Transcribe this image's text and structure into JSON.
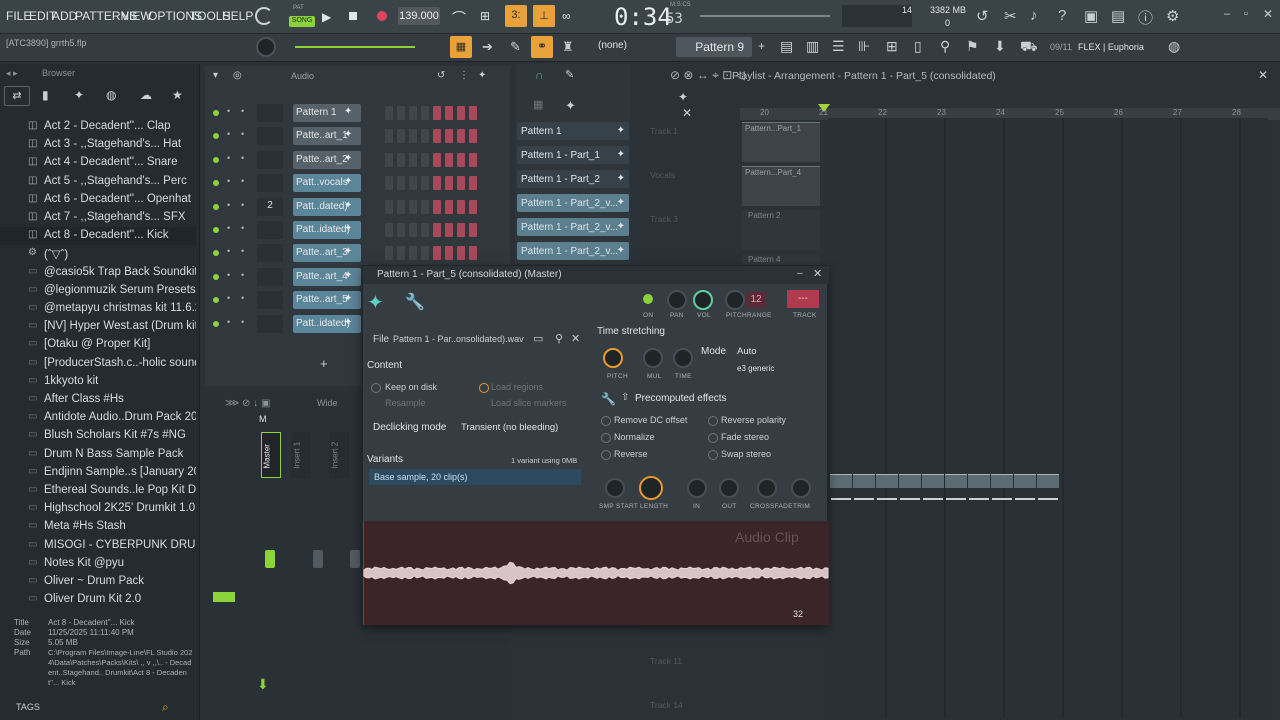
{
  "menu": [
    "FILE",
    "EDIT",
    "ADD",
    "PATTERNS",
    "VIEW",
    "OPTIONS",
    "TOOLS",
    "HELP"
  ],
  "transport": {
    "song_label": "SONG",
    "pat_label": "PAT",
    "tempo": "139.000",
    "time_main": "0:34",
    "time_sub": "53",
    "time_label": "M:S:CS",
    "meter_a": "14",
    "memory": "3382 MB",
    "memory_b": "0"
  },
  "hint": {
    "file": "[ATC3890] grrth5.flp",
    "snap": "(none)",
    "pattern": "Pattern 9",
    "version": "09/11",
    "plugin": "FLEX | Euphoria"
  },
  "browser": {
    "title": "Browser",
    "items": [
      {
        "label": "Act 2 - Decadent''... Clap",
        "icon": "file-icon"
      },
      {
        "label": "Act 3 - ,,Stagehand's... Hat",
        "icon": "file-icon"
      },
      {
        "label": "Act 4 -  Decadent''... Snare",
        "icon": "file-icon"
      },
      {
        "label": "Act 5 - ,,Stagehand's... Perc",
        "icon": "file-icon"
      },
      {
        "label": "Act 6 - Decadent''... Openhat",
        "icon": "file-icon"
      },
      {
        "label": "Act 7 - ,,Stagehand's... SFX",
        "icon": "file-icon"
      },
      {
        "label": "Act 8 - Decadent''... Kick",
        "icon": "file-icon"
      },
      {
        "label": "(ˆ▽ˆ)",
        "icon": "gear-icon"
      },
      {
        "label": "@casio5k Trap Back Soundkit",
        "icon": "folder-icon"
      },
      {
        "label": "@legionmuzik Serum Presets",
        "icon": "folder-icon"
      },
      {
        "label": "@metapyu christmas kit 11.6.25",
        "icon": "folder-icon"
      },
      {
        "label": "[NV] Hyper West.ast (Drum kits)",
        "icon": "folder-icon"
      },
      {
        "label": "[Otaku @ Proper Kit]",
        "icon": "folder-icon"
      },
      {
        "label": "[ProducerStash.c..-holic soundkit",
        "icon": "folder-icon"
      },
      {
        "label": "1kkyoto kit",
        "icon": "folder-icon"
      },
      {
        "label": "After Class #Hs",
        "icon": "folder-icon"
      },
      {
        "label": "Antidote Audio..Drum Pack 2018",
        "icon": "folder-icon"
      },
      {
        "label": "Blush Scholars Kit  #7s #NG",
        "icon": "folder-icon"
      },
      {
        "label": "Drum N Bass Sample Pack",
        "icon": "folder-icon"
      },
      {
        "label": "Endjinn Sample..s [January 2023]",
        "icon": "folder-icon"
      },
      {
        "label": "Ethereal Sounds..le Pop Kit Demo",
        "icon": "folder-icon"
      },
      {
        "label": "Highschool 2K25' Drumkit 1.0",
        "icon": "folder-icon"
      },
      {
        "label": "Meta #Hs Stash",
        "icon": "folder-icon"
      },
      {
        "label": "MISOGI - CYBERPUNK DRUMKIT",
        "icon": "folder-icon"
      },
      {
        "label": "Notes Kit @pyu",
        "icon": "folder-icon"
      },
      {
        "label": "Oliver ~ Drum Pack",
        "icon": "folder-icon"
      },
      {
        "label": "Oliver Drum Kit 2.0",
        "icon": "folder-icon"
      }
    ],
    "info": {
      "title_k": "Title",
      "title_v": "Act 8 - Decadent''... Kick",
      "date_k": "Date",
      "date_v": "11/25/2025 11:11:40 PM",
      "size_k": "Size",
      "size_v": "5.05 MB",
      "path_k": "Path",
      "path_v": "C:\\Program Files\\Image-Line\\FL Studio 2024\\Data\\Patches\\Packs\\Kits\\ ,, v  ,,\\.. - Decadent..Stagehand.. Drumkit\\Act 8 - Decadent''... Kick"
    },
    "tags_label": "TAGS"
  },
  "rack": {
    "title": "Audio",
    "channels": [
      {
        "name": "Pattern 1",
        "num": "",
        "blue": false
      },
      {
        "name": "Patte..art_1",
        "num": "",
        "blue": false
      },
      {
        "name": "Patte..art_2",
        "num": "",
        "blue": false
      },
      {
        "name": "Patt..vocals",
        "num": "",
        "blue": true
      },
      {
        "name": "Patt..dated)",
        "num": "2",
        "blue": true
      },
      {
        "name": "Patt..idated)",
        "num": "",
        "blue": true
      },
      {
        "name": "Patte..art_3",
        "num": "",
        "blue": true
      },
      {
        "name": "Patte..art_4",
        "num": "",
        "blue": true
      },
      {
        "name": "Patte..art_5",
        "num": "",
        "blue": true
      },
      {
        "name": "Patt..idated)",
        "num": "",
        "blue": true
      }
    ],
    "add_label": "+"
  },
  "picker": [
    "Pattern 1",
    "Pattern 1 - Part_1",
    "Pattern 1 - Part_2",
    "Pattern 1 - Part_2_v...",
    "Pattern 1 - Part_2_v...",
    "Pattern 1 - Part_2_v..."
  ],
  "playlist": {
    "title": "Playlist - Arrangement - Pattern 1 - Part_5 (consolidated)",
    "bars": [
      "20",
      "21",
      "22",
      "23",
      "24",
      "25",
      "26",
      "27",
      "28"
    ],
    "tracks": [
      "Track 1",
      "Vocals",
      "Track 3",
      "Track 11",
      "Track 14"
    ],
    "clips": [
      "Pattern...Part_1",
      "Pattern...Part_4",
      "Pattern 2",
      "Pattern 4"
    ]
  },
  "mixer": {
    "label": "Wide",
    "strips": [
      "Master",
      "Insert 1",
      "Insert 2"
    ],
    "m_label": "M"
  },
  "clip": {
    "title": "Pattern 1 - Part_5 (consolidated) (Master)",
    "file_label": "File",
    "file_name": "Pattern 1 - Par..onsolidated).wav",
    "content_label": "Content",
    "keep_disk": "Keep on disk",
    "load_regions": "Load regions",
    "resample": "Resample",
    "load_slice": "Load slice markers",
    "declick_label": "Declicking mode",
    "declick_value": "Transient (no bleeding)",
    "variants_label": "Variants",
    "variants_info": "1 variant using 0MB",
    "variant_item": "Base sample, 20 clip(s)",
    "knob_labels": [
      "ON",
      "PAN",
      "VOL",
      "PITCH",
      "RANGE",
      "TRACK"
    ],
    "range_value": "12",
    "track_value": "---",
    "ts_label": "Time stretching",
    "mode_label": "Mode",
    "mode_value": "Auto",
    "ts_knobs": [
      "PITCH",
      "MUL",
      "TIME"
    ],
    "ts_method": "e3 generic",
    "pre_label": "Precomputed effects",
    "effects": [
      "Remove DC offset",
      "Reverse polarity",
      "Normalize",
      "Fade stereo",
      "Reverse",
      "Swap stereo"
    ],
    "bottom_knobs": [
      "SMP START",
      "LENGTH",
      "IN",
      "OUT",
      "CROSSFADE",
      "TRIM"
    ],
    "wave_label": "Audio Clip",
    "wave_num": "32"
  },
  "colors": {
    "accent": "#e89b2c",
    "green": "#8cd33a",
    "wave_bg": "#3b2529",
    "highlight": "#5b7f8f"
  }
}
